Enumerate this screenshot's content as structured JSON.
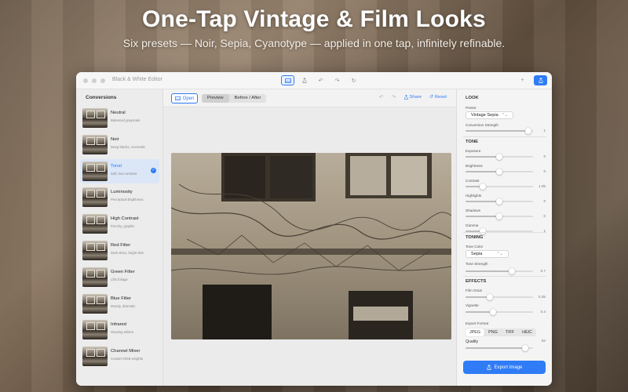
{
  "headline": "One-Tap Vintage & Film Looks",
  "subheadline": "Six presets — Noir, Sepia, Cyanotype — applied in one tap, infinitely refinable.",
  "window": {
    "title": "Black & White Editor"
  },
  "sidebar": {
    "heading": "Conversions",
    "selected_index": 2,
    "items": [
      {
        "name": "Neutral",
        "desc": "Balanced grayscale"
      },
      {
        "name": "Noir",
        "desc": "Deep blacks, cinematic"
      },
      {
        "name": "Tonal",
        "desc": "Soft, low contrast"
      },
      {
        "name": "Luminosity",
        "desc": "Perceptual brightness"
      },
      {
        "name": "High Contrast",
        "desc": "Punchy, graphic"
      },
      {
        "name": "Red Filter",
        "desc": "Dark skies, bright skin"
      },
      {
        "name": "Green Filter",
        "desc": "Lifts foliage"
      },
      {
        "name": "Blue Filter",
        "desc": "Moody, dramatic"
      },
      {
        "name": "Infrared",
        "desc": "Glowing whites"
      },
      {
        "name": "Channel Mixer",
        "desc": "Custom RGB weights"
      }
    ]
  },
  "toolbar": {
    "open_label": "Open",
    "view_modes": [
      "Preview",
      "Before / After"
    ],
    "active_view_mode": "Preview",
    "share_label": "Share",
    "reset_label": "Reset"
  },
  "look": {
    "title": "LOOK",
    "preset_label": "Preset",
    "preset_value": "Vintage Sepia",
    "conversion_strength": {
      "label": "Conversion Strength",
      "value": "1",
      "position": 0.97
    }
  },
  "tone": {
    "title": "TONE",
    "sliders": [
      {
        "label": "Exposure",
        "value": "0",
        "position": 0.5
      },
      {
        "label": "Brightness",
        "value": "0",
        "position": 0.5
      },
      {
        "label": "Contrast",
        "value": "1.05",
        "position": 0.23
      },
      {
        "label": "Highlights",
        "value": "0",
        "position": 0.5
      },
      {
        "label": "Shadows",
        "value": "0",
        "position": 0.5
      },
      {
        "label": "Gamma",
        "value": "1",
        "position": 0.23
      }
    ]
  },
  "toning": {
    "title": "TONING",
    "tone_color_label": "Tone Color",
    "tone_color_value": "Sepia",
    "tone_strength": {
      "label": "Tone Strength",
      "value": "0.7",
      "position": 0.7
    }
  },
  "effects": {
    "title": "EFFECTS",
    "sliders": [
      {
        "label": "Film Grain",
        "value": "0.35",
        "position": 0.35
      },
      {
        "label": "Vignette",
        "value": "0.4",
        "position": 0.4
      }
    ],
    "export_format_label": "Export Format",
    "formats": [
      "JPEG",
      "PNG",
      "TIFF",
      "HEIC"
    ],
    "active_format": "JPEG",
    "quality": {
      "label": "Quality",
      "value": "92",
      "position": 0.92
    },
    "export_label": "Export Image"
  },
  "colors": {
    "accent": "#2f7cf6"
  }
}
